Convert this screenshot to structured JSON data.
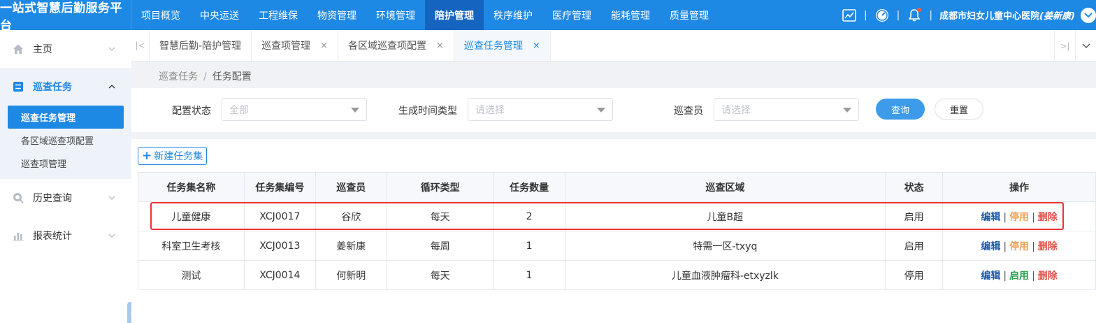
{
  "app_title": "一站式智慧后勤服务平台",
  "top_nav": [
    {
      "label": "项目概览"
    },
    {
      "label": "中央运送"
    },
    {
      "label": "工程维保"
    },
    {
      "label": "物资管理"
    },
    {
      "label": "环境管理"
    },
    {
      "label": "陪护管理",
      "active": true
    },
    {
      "label": "秩序维护"
    },
    {
      "label": "医疗管理"
    },
    {
      "label": "能耗管理"
    },
    {
      "label": "质量管理"
    }
  ],
  "header_right": {
    "hospital": "成都市妇女儿童中心医院",
    "user": "(姜新康)",
    "separator": "|",
    "icons": [
      "chart-icon",
      "dashboard-icon",
      "bell-icon",
      "user-menu-icon"
    ]
  },
  "sidebar": {
    "home": "主页",
    "inspection_group": "巡查任务",
    "inspection_items": [
      "巡查任务管理",
      "各区域巡查项配置",
      "巡查项管理"
    ],
    "history": "历史查询",
    "reports": "报表统计"
  },
  "tabs": [
    {
      "label": "智慧后勤-陪护管理",
      "closable": false
    },
    {
      "label": "巡查项管理",
      "closable": true
    },
    {
      "label": "各区域巡查项配置",
      "closable": true
    },
    {
      "label": "巡查任务管理",
      "closable": true,
      "active": true
    }
  ],
  "breadcrumb": {
    "parent": "巡查任务",
    "current": "任务配置"
  },
  "filters": {
    "config_status": {
      "label": "配置状态",
      "value": "全部"
    },
    "gen_time_type": {
      "label": "生成时间类型",
      "placeholder": "请选择"
    },
    "inspector": {
      "label": "巡查员",
      "placeholder": "请选择"
    },
    "query_label": "查询",
    "reset_label": "重置"
  },
  "new_button": "新建任务集",
  "table": {
    "headers": [
      "任务集名称",
      "任务集编号",
      "巡查员",
      "循环类型",
      "任务数量",
      "巡查区域",
      "状态",
      "操作"
    ],
    "rows": [
      {
        "name": "儿童健康",
        "code": "XCJ0017",
        "inspector": "谷欣",
        "cycle": "每天",
        "count": "2",
        "area": "儿童B超",
        "status": "启用",
        "toggle": "停用"
      },
      {
        "name": "科室卫生考核",
        "code": "XCJ0013",
        "inspector": "姜新康",
        "cycle": "每周",
        "count": "1",
        "area": "特需一区-txyq",
        "status": "启用",
        "toggle": "停用"
      },
      {
        "name": "测试",
        "code": "XCJ0014",
        "inspector": "何新明",
        "cycle": "每天",
        "count": "1",
        "area": "儿童血液肿瘤科-etxyzlk",
        "status": "停用",
        "toggle": "启用"
      }
    ],
    "ops": {
      "edit": "编辑",
      "delete": "删除",
      "sep": "|"
    }
  },
  "colors": {
    "primary": "#1e88e5",
    "nav_active": "#1565c0",
    "highlight": "#ee3333",
    "stop": "#f0a050",
    "start": "#2aa44f",
    "delete": "#e5534b"
  }
}
